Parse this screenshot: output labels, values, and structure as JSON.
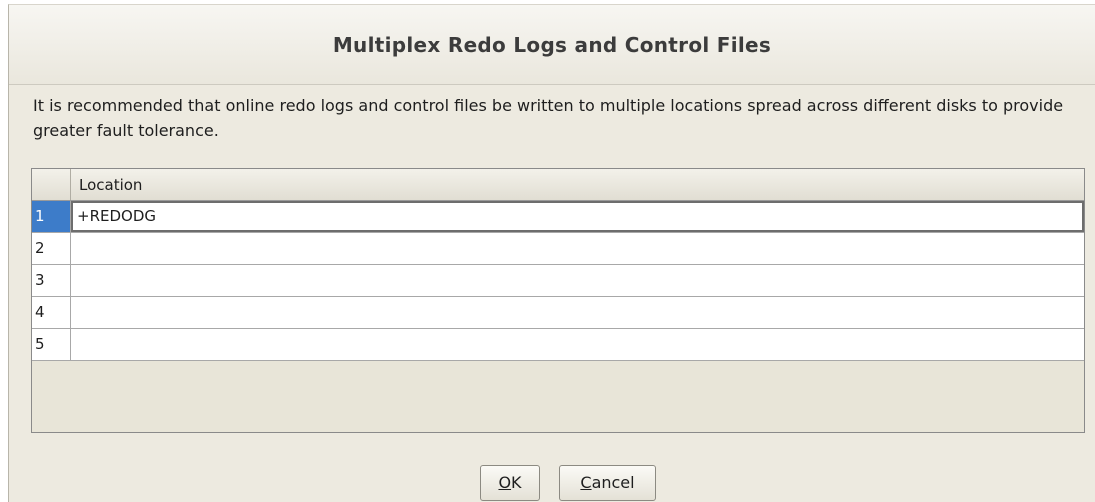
{
  "dialog": {
    "title": "Multiplex Redo Logs and Control Files",
    "description": "It is recommended that online redo logs and control files be  written to multiple locations spread across different disks to provide greater fault tolerance."
  },
  "table": {
    "column_header": "Location",
    "rows": [
      {
        "num": "1",
        "location": "+REDODG",
        "selected": true
      },
      {
        "num": "2",
        "location": ""
      },
      {
        "num": "3",
        "location": ""
      },
      {
        "num": "4",
        "location": ""
      },
      {
        "num": "5",
        "location": ""
      }
    ]
  },
  "buttons": {
    "ok": {
      "mnemonic": "O",
      "rest": "K"
    },
    "cancel": {
      "mnemonic": "C",
      "rest": "ancel"
    }
  },
  "colors": {
    "selection": "#3d7cc9",
    "dialog_background": "#edeae0"
  }
}
